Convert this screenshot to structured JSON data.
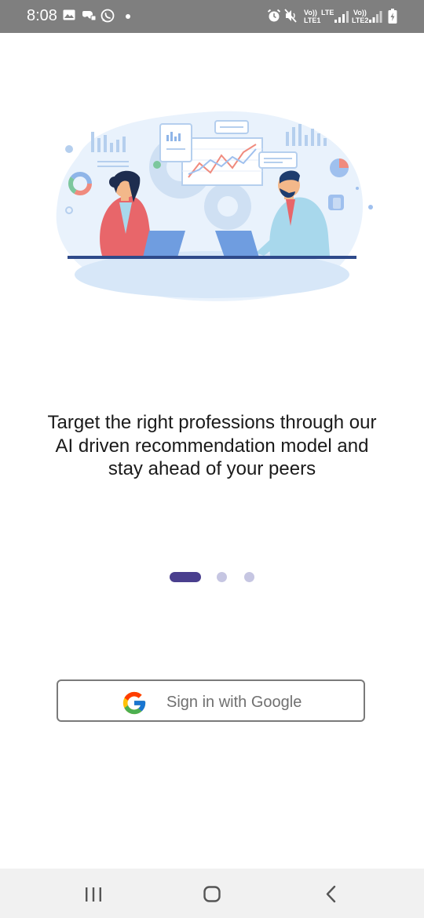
{
  "status_bar": {
    "time": "8:08",
    "sim1_volte": "Vo))",
    "sim1_lte": "LTE",
    "sim1_label": "LTE1",
    "sim2_volte": "Vo))",
    "sim2_label": "LTE2"
  },
  "onboarding": {
    "message": "Target the right professions through our AI driven recommendation model and stay ahead of your peers",
    "page_count": 3,
    "active_page": 1
  },
  "signin": {
    "label": "Sign in with Google"
  },
  "colors": {
    "status_bar_bg": "#7f7f7f",
    "indicator_active": "#4a3f8e",
    "indicator_inactive": "#c6c6e2",
    "nav_bar_bg": "#f1f1f1"
  },
  "icons": {
    "status_left": [
      "gallery-icon",
      "game-controller-icon",
      "whatsapp-icon"
    ],
    "status_right": [
      "alarm-icon",
      "mute-icon",
      "signal-icon",
      "battery-icon"
    ],
    "nav": [
      "recent-apps-icon",
      "home-icon",
      "back-icon"
    ]
  }
}
